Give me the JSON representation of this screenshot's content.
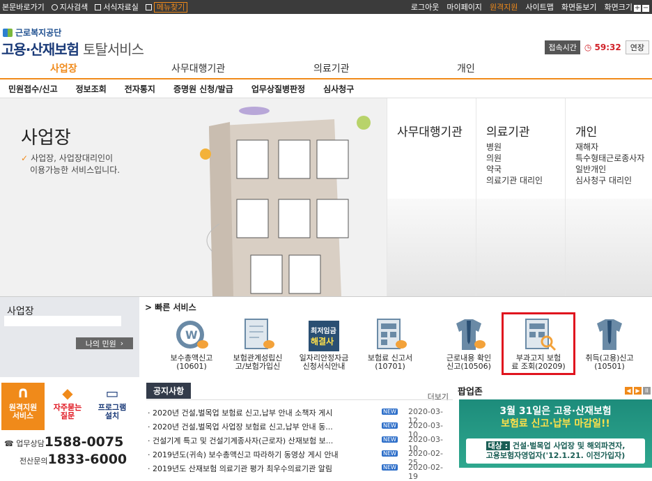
{
  "skip_links": {
    "main": "본문바로가기",
    "branch": "지사검색",
    "forms": "서식자료실",
    "menu": "메뉴찾기"
  },
  "utility": {
    "logout": "로그아웃",
    "mypage": "마이페이지",
    "remote": "원격지원",
    "sitemap": "사이트맵",
    "zoom_view": "화면돋보기",
    "screen_size": "화면크기"
  },
  "logo": {
    "org": "근로복지공단",
    "main": "고용·산재보험",
    "sub": "토탈서비스"
  },
  "session": {
    "label": "접속시간",
    "time": "59:32",
    "extend": "연장"
  },
  "main_nav": [
    "사업장",
    "사무대행기관",
    "의료기관",
    "개인"
  ],
  "sub_nav": [
    "민원접수/신고",
    "정보조회",
    "전자통지",
    "증명원 신청/발급",
    "업무상질병판정",
    "심사청구"
  ],
  "hero": {
    "title": "사업장",
    "desc1": "사업장, 사업장대리인이",
    "desc2": "이용가능한 서비스입니다."
  },
  "panels": [
    {
      "title": "사무대행기관",
      "items": []
    },
    {
      "title": "의료기관",
      "items": [
        "병원",
        "의원",
        "약국",
        "의료기관 대리인"
      ]
    },
    {
      "title": "개인",
      "items": [
        "재해자",
        "특수형태근로종사자",
        "일반개인",
        "심사청구 대리인"
      ]
    }
  ],
  "biz_box": {
    "title": "사업장",
    "my_button": "나의 민원"
  },
  "quick": {
    "title": "빠른 서비스",
    "items": [
      {
        "l1": "보수총액신고",
        "l2": "(10601)",
        "icon": "coin-mouse-icon"
      },
      {
        "l1": "보험관계성립신",
        "l2": "고/보험가입신",
        "icon": "document-mouse-icon"
      },
      {
        "l1": "일자리안정자금",
        "l2": "신청서식안내",
        "icon": "minimum-wage-icon"
      },
      {
        "l1": "보험료 신고서",
        "l2": "(10701)",
        "icon": "calculator-mouse-icon"
      },
      {
        "l1": "근로내용 확인",
        "l2": "신고(10506)",
        "icon": "shirt-mouse-icon"
      },
      {
        "l1": "부과고지 보험",
        "l2": "료 조회(20209)",
        "icon": "calculator-search-icon"
      },
      {
        "l1": "취득(고용)신고",
        "l2": "(10501)",
        "icon": "shirt-tie-icon"
      }
    ],
    "wage_badge1": "최저임금",
    "wage_badge2": "해결사"
  },
  "support": {
    "remote": "원격지원 서비스",
    "faq": "자주묻는 질문",
    "program": "프로그램 설치",
    "consult_label": "업무상담",
    "consult_num": "1588-0075",
    "it_label": "전산문의",
    "it_num": "1833-6000"
  },
  "notice": {
    "title": "공지사항",
    "more": "더보기",
    "rows": [
      {
        "text": "2020년 건설,벌목업 보험료 신고,납부 안내 소책자 게시",
        "date": "2020-03-12"
      },
      {
        "text": "2020년 건설,벌목업 사업장 보험료 신고,납부 안내 동...",
        "date": "2020-03-10"
      },
      {
        "text": "건설기계 특고 및 건설기계종사자(근로자) 산재보험 보...",
        "date": "2020-03-10"
      },
      {
        "text": "2019년도(귀속) 보수총액신고 따라하기 동영상 게시 안내",
        "date": "2020-02-25"
      },
      {
        "text": "2019년도 산재보험 의료기관 평가 최우수의료기관 알림",
        "date": "2020-02-19"
      }
    ],
    "new_label": "NEW"
  },
  "popup": {
    "title": "팝업존",
    "line1": "3월 31일은 고용·산재보험",
    "line2": "보험료 신고·납부 마감일!!",
    "tag": "대상 :",
    "line3": "건설·벌목업 사업장 및 해외파견자,",
    "line4": "고용보험자영업자('12.1.21. 이전가입자)"
  }
}
